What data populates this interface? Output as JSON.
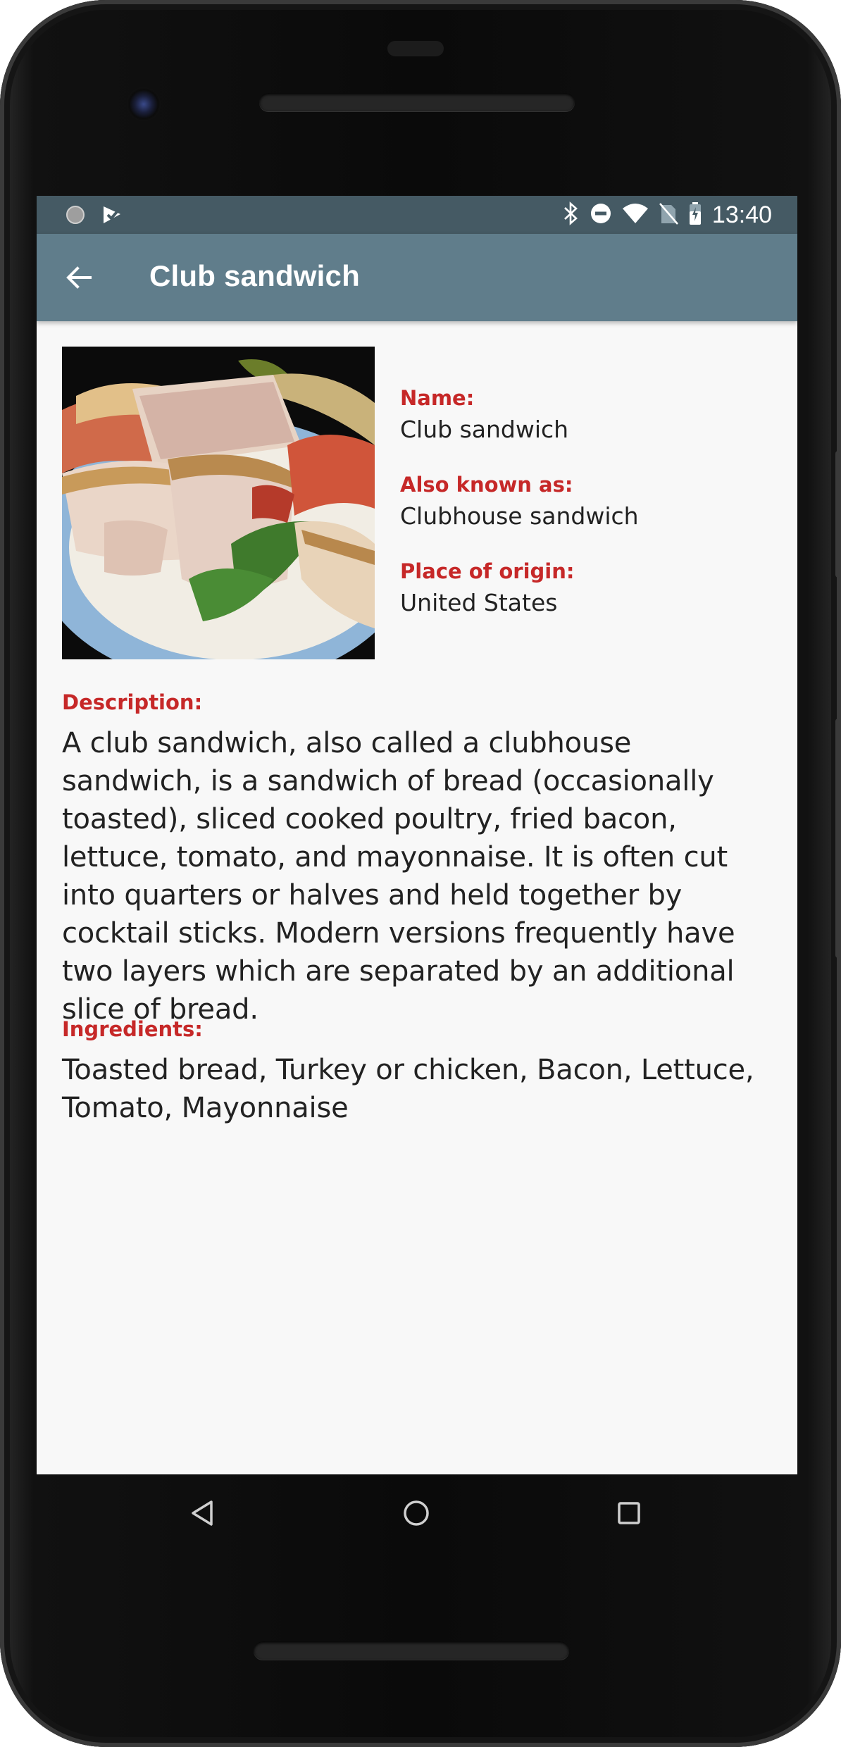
{
  "status_bar": {
    "time": "13:40",
    "left_icons": [
      "circle-notification-icon",
      "play-check-icon"
    ],
    "right_icons": [
      "bluetooth-icon",
      "do-not-disturb-icon",
      "wifi-icon",
      "no-sim-icon",
      "battery-icon"
    ]
  },
  "app_bar": {
    "title": "Club sandwich",
    "back_icon": "arrow-back-icon"
  },
  "facts": {
    "name_label": "Name:",
    "name_value": "Club sandwich",
    "aka_label": "Also known as:",
    "aka_value": "Clubhouse sandwich",
    "origin_label": "Place of origin:",
    "origin_value": "United States"
  },
  "description": {
    "label": "Description:",
    "text": "A club sandwich, also called a clubhouse sandwich, is a sandwich of bread (occasionally toasted), sliced cooked poultry, fried bacon, lettuce, tomato, and mayonnaise. It is often cut into quarters or halves and held together by cocktail sticks. Modern versions frequently have two layers which are separated by an additional slice of bread."
  },
  "ingredients": {
    "label": "Ingredients:",
    "text": "Toasted bread, Turkey or chicken, Bacon, Lettuce, Tomato, Mayonnaise"
  },
  "nav_bar": {
    "icons": [
      "back-triangle-icon",
      "home-circle-icon",
      "recents-square-icon"
    ]
  },
  "colors": {
    "status_bar": "#455a64",
    "app_bar": "#607d8b",
    "label_red": "#c62828",
    "background": "#f8f8f8"
  }
}
